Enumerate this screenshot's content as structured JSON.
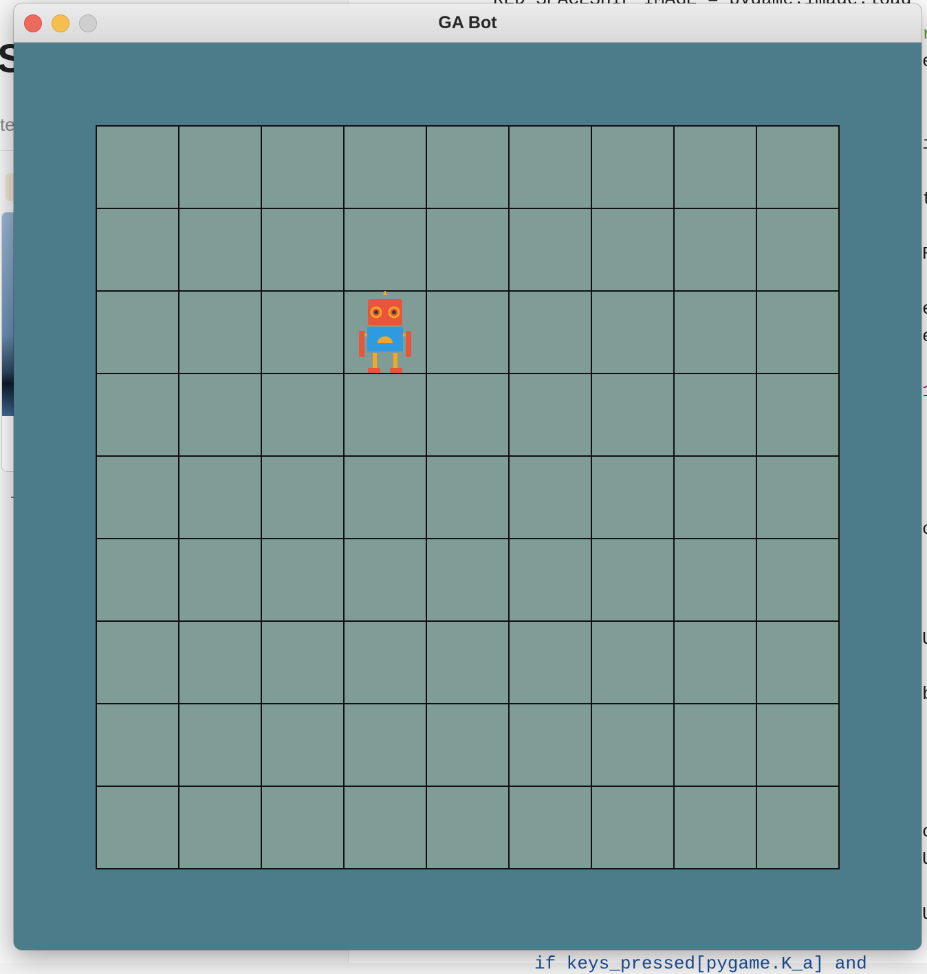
{
  "window": {
    "title": "GA Bot",
    "controls": [
      "close",
      "minimize",
      "zoom"
    ]
  },
  "colors": {
    "background": "#4c7c8a",
    "cell": "#809c96",
    "grid_line": "#101010",
    "robot_head": "#e8553a",
    "robot_body": "#2e9be0",
    "robot_accent": "#f5a623"
  },
  "board": {
    "rows": 9,
    "cols": 9,
    "robot_position": {
      "row": 3,
      "col": 4
    },
    "robot_icon": "robot-icon"
  },
  "background_apps": {
    "left_big_letter": "S",
    "left_small_text": "te",
    "code_fragments": [
      {
        "text": "RED_SPACESHIP_IMAGE = pygame.image.load",
        "style": ""
      },
      {
        "text": "r",
        "style": "green"
      },
      {
        "text": "e",
        "style": ""
      },
      {
        "text": "i",
        "style": ""
      },
      {
        "text": "t",
        "style": ""
      },
      {
        "text": "R",
        "style": ""
      },
      {
        "text": "e",
        "style": ""
      },
      {
        "text": "e",
        "style": ""
      },
      {
        "text": "1",
        "style": "red"
      },
      {
        "text": "c",
        "style": ""
      },
      {
        "text": "U",
        "style": ""
      },
      {
        "text": "b",
        "style": ""
      },
      {
        "text": "c",
        "style": ""
      },
      {
        "text": "U",
        "style": ""
      },
      {
        "text": "U",
        "style": ""
      },
      {
        "text": "if keys_pressed[pygame.K_a] and",
        "style": "blue"
      }
    ]
  }
}
